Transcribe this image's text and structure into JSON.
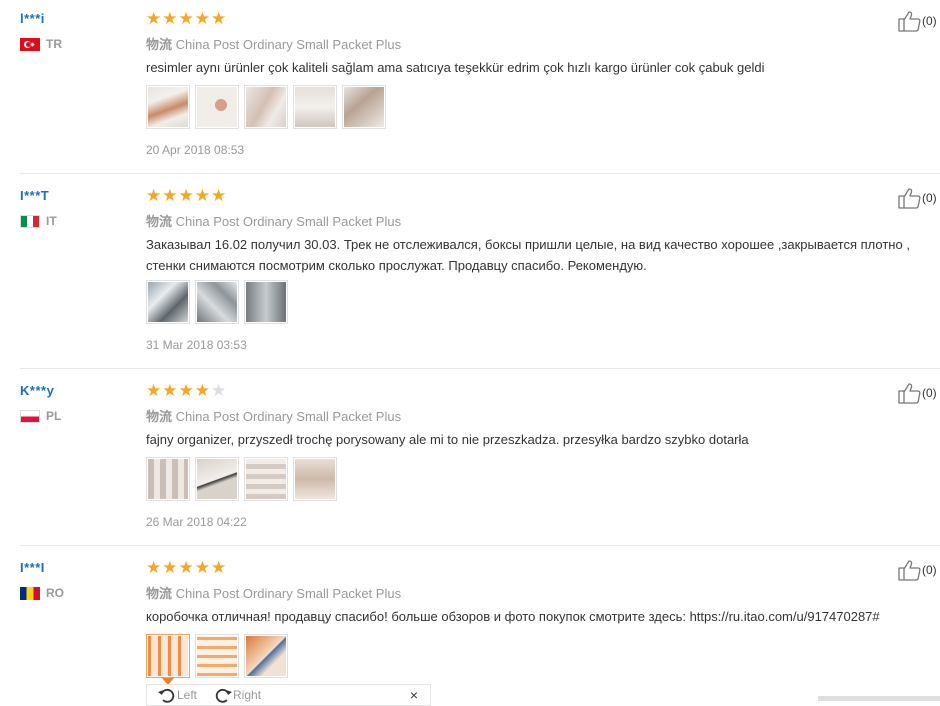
{
  "reviews": [
    {
      "user": "l***i",
      "country": "TR",
      "flag_icon": "turkey-flag-icon",
      "rating": 5,
      "shipping_label": "物流",
      "shipping_method": "China Post Ordinary Small Packet Plus",
      "text": "resimler aynı ürünler çok kaliteli sağlam ama satıcıya teşekkür edrim çok hızlı kargo ürünler cok çabuk geldi",
      "photo_count": 5,
      "date": "20 Apr 2018 08:53",
      "likes": "(0)"
    },
    {
      "user": "I***T",
      "country": "IT",
      "flag_icon": "italy-flag-icon",
      "rating": 5,
      "shipping_label": "物流",
      "shipping_method": "China Post Ordinary Small Packet Plus",
      "text": "Заказывал 16.02 получил 30.03. Трек не отслеживался, боксы пришли целые, на вид качество хорошее ,закрывается плотно , стенки снимаются посмотрим сколько прослужат. Продавцу спасибо. Рекомендую.",
      "photo_count": 3,
      "date": "31 Mar 2018 03:53",
      "likes": "(0)"
    },
    {
      "user": "K***y",
      "country": "PL",
      "flag_icon": "poland-flag-icon",
      "rating": 4,
      "shipping_label": "物流",
      "shipping_method": "China Post Ordinary Small Packet Plus",
      "text": "fajny organizer, przyszedł trochę porysowany ale mi to nie przeszkadza. przesyłka bardzo szybko dotarła",
      "photo_count": 4,
      "date": "26 Mar 2018 04:22",
      "likes": "(0)"
    },
    {
      "user": "I***I",
      "country": "RO",
      "flag_icon": "romania-flag-icon",
      "rating": 5,
      "shipping_label": "物流",
      "shipping_method": "China Post Ordinary Small Packet Plus",
      "text": "коробочка отличная! продавцу спасибо! больше обзоров и фото покупок смотрите здесь: https://ru.itao.com/u/917470287#",
      "photo_count": 3,
      "selected_photo": 1,
      "likes": "(0)"
    }
  ],
  "image_viewer": {
    "left_label": "Left",
    "right_label": "Right",
    "close_icon": "×"
  },
  "colors": {
    "star": "#f5a623",
    "username": "#1a6fb5",
    "muted": "#999999"
  }
}
